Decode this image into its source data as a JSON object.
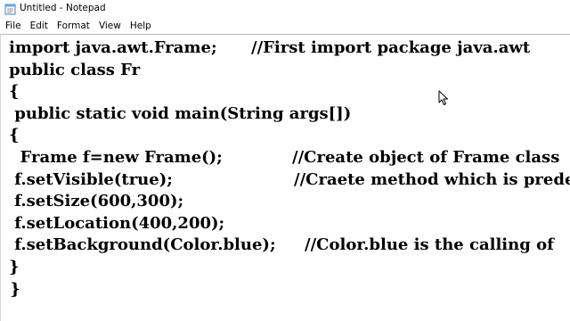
{
  "window": {
    "title": "Untitled - Notepad",
    "icon": "notepad-icon"
  },
  "menu": {
    "items": [
      "File",
      "Edit",
      "Format",
      "View",
      "Help"
    ]
  },
  "editor": {
    "lines": [
      {
        "code": "import java.awt.Frame;",
        "comment": "//First import package java.awt"
      },
      {
        "code": "public class Fr",
        "comment": ""
      },
      {
        "code": "{",
        "comment": ""
      },
      {
        "code": " public static void main(String args[])",
        "comment": ""
      },
      {
        "code": "{",
        "comment": ""
      },
      {
        "code": "  Frame f=new Frame();",
        "comment": "//Create object of Frame class"
      },
      {
        "code": " f.setVisible(true);",
        "comment": "//Craete method which is predef"
      },
      {
        "code": " f.setSize(600,300);",
        "comment": ""
      },
      {
        "code": " f.setLocation(400,200);",
        "comment": ""
      },
      {
        "code": " f.setBackground(Color.blue);",
        "comment": "//Color.blue is the calling of"
      },
      {
        "code": "}",
        "comment": ""
      },
      {
        "code": " }",
        "comment": ""
      }
    ]
  },
  "colors": {
    "background": "#ffffff",
    "text": "#000000"
  }
}
